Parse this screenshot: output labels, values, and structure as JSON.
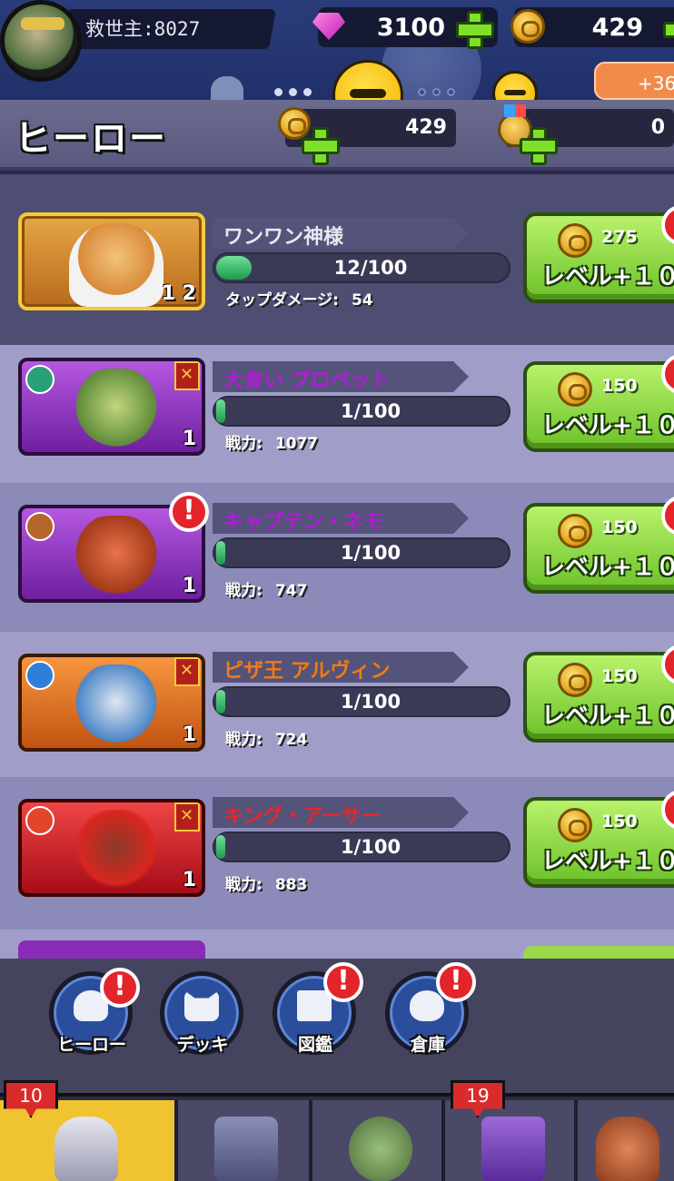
{
  "player": {
    "name": "救世主:8027"
  },
  "currencies": {
    "gems": "3100",
    "coins": "429",
    "bonus": "+36"
  },
  "header": {
    "title": "ヒーロー",
    "coins": "429",
    "medals": "0"
  },
  "heroes": [
    {
      "name": "ワンワン神様",
      "name_color": "#e8e8f0",
      "level": "1 2",
      "progress": "12/100",
      "progress_fraction": 0.12,
      "stat_label": "タップダメージ:",
      "stat_value": "54",
      "cost": "275",
      "button": "レベル+１０",
      "card": "gold"
    },
    {
      "name": "大食い プロペット",
      "name_color": "#b21bd6",
      "level": "1",
      "progress": "1/100",
      "progress_fraction": 0.01,
      "stat_label": "戦力:",
      "stat_value": "1077",
      "cost": "150",
      "button": "レベル+１０",
      "card": "purple",
      "element": "wind"
    },
    {
      "name": "キャプテン・ネモ",
      "name_color": "#b21bd6",
      "level": "1",
      "progress": "1/100",
      "progress_fraction": 0.01,
      "stat_label": "戦力:",
      "stat_value": "747",
      "cost": "150",
      "button": "レベル+１０",
      "card": "purple",
      "element": "earth"
    },
    {
      "name": "ピザ王 アルヴィン",
      "name_color": "#f57a12",
      "level": "1",
      "progress": "1/100",
      "progress_fraction": 0.01,
      "stat_label": "戦力:",
      "stat_value": "724",
      "cost": "150",
      "button": "レベル+１０",
      "card": "orange",
      "element": "water"
    },
    {
      "name": "キング・アーサー",
      "name_color": "#e8262a",
      "level": "1",
      "progress": "1/100",
      "progress_fraction": 0.01,
      "stat_label": "戦力:",
      "stat_value": "883",
      "cost": "150",
      "button": "レベル+１０",
      "card": "red",
      "element": "fire"
    }
  ],
  "subnav": [
    {
      "label": "ヒーロー",
      "icon": "mask-icon",
      "alert": true
    },
    {
      "label": "デッキ",
      "icon": "cat-mask-icon",
      "alert": false
    },
    {
      "label": "図鑑",
      "icon": "book-icon",
      "alert": true
    },
    {
      "label": "倉庫",
      "icon": "bag-icon",
      "alert": true
    }
  ],
  "tabs": [
    {
      "name": "heroes-tab",
      "badge": "10",
      "active": true
    },
    {
      "name": "weapons-tab",
      "badge": "",
      "active": false
    },
    {
      "name": "battle-tab",
      "badge": "",
      "active": false
    },
    {
      "name": "chest-tab",
      "badge": "19",
      "active": false
    },
    {
      "name": "boss-tab",
      "badge": "",
      "active": false
    }
  ],
  "colors": {
    "accent_green": "#7fe02a",
    "alert_red": "#e3242b",
    "tab_active": "#f0c431"
  }
}
